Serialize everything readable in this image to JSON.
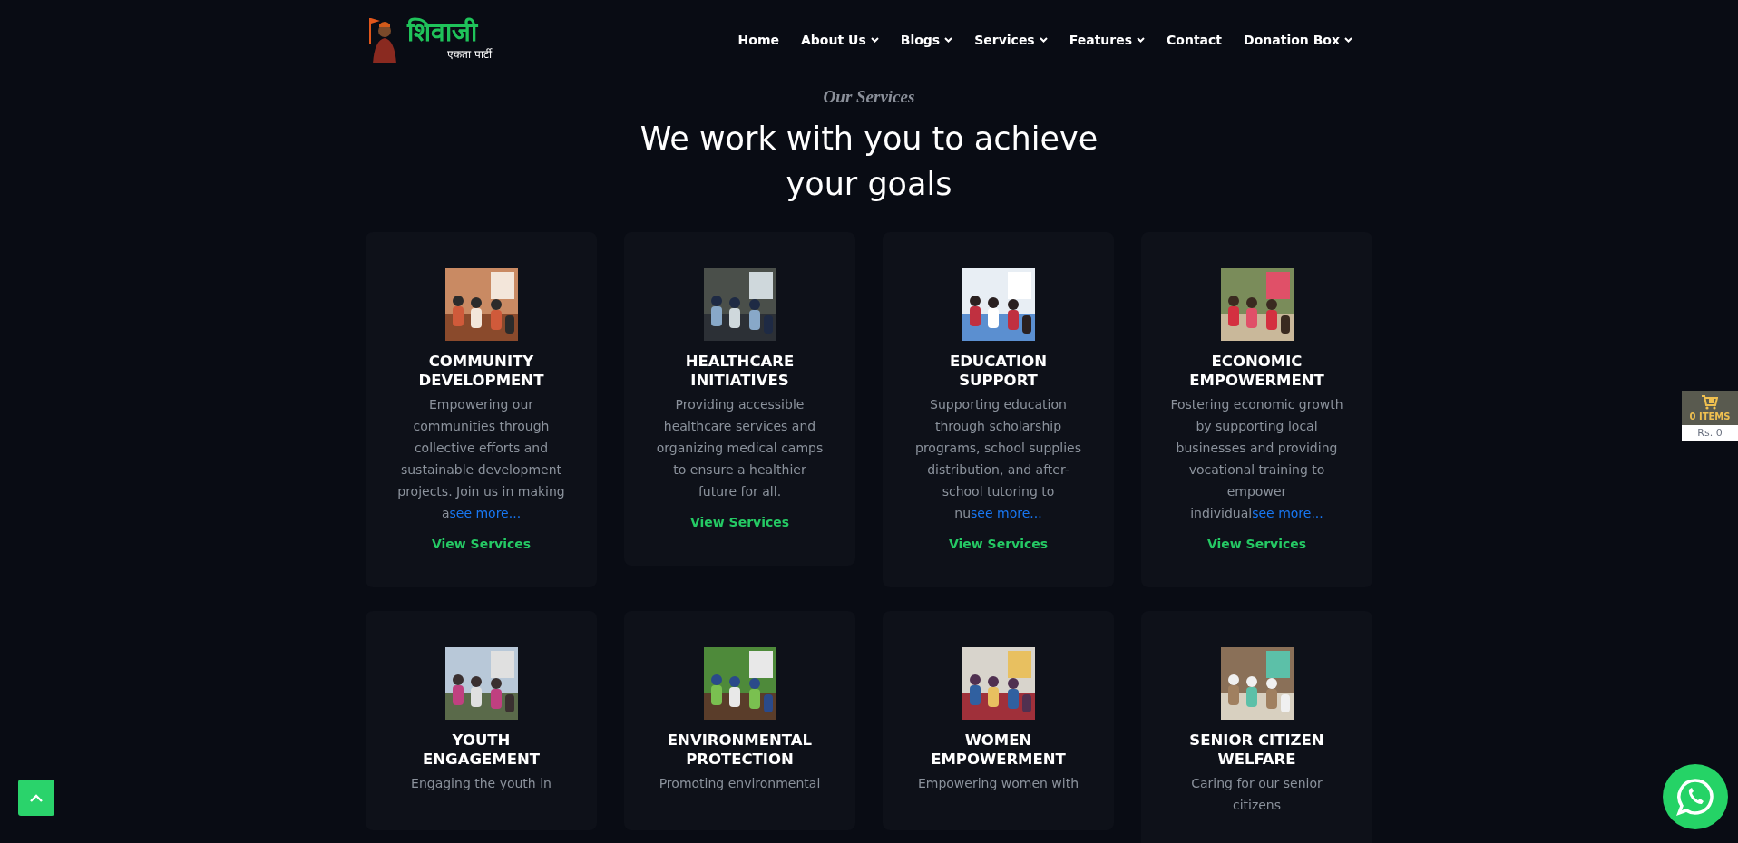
{
  "logo": {
    "title": "शिवाजी",
    "subtitle": "एकता पार्टी"
  },
  "nav": [
    {
      "label": "Home",
      "dropdown": false
    },
    {
      "label": "About Us",
      "dropdown": true
    },
    {
      "label": "Blogs",
      "dropdown": true
    },
    {
      "label": "Services",
      "dropdown": true
    },
    {
      "label": "Features",
      "dropdown": true
    },
    {
      "label": "Contact",
      "dropdown": false
    },
    {
      "label": "Donation Box",
      "dropdown": true
    }
  ],
  "section": {
    "eyebrow": "Our Services",
    "heading": "We work with you to achieve your goals"
  },
  "services": [
    {
      "title": "COMMUNITY DEVELOPMENT",
      "description": "Empowering our communities through collective efforts and sustainable development projects. Join us in making a",
      "link": "see more...",
      "action": "View Services"
    },
    {
      "title": "HEALTHCARE INITIATIVES",
      "description": "Providing accessible healthcare services and organizing medical camps to ensure a healthier future for all.",
      "action": "View Services"
    },
    {
      "title": "EDUCATION SUPPORT",
      "description": "Supporting education through scholarship programs, school supplies distribution, and after-school tutoring to nu",
      "link": "see more...",
      "action": "View Services"
    },
    {
      "title": "ECONOMIC EMPOWERMENT",
      "description": "Fostering economic growth by supporting local businesses and providing vocational training to empower individual",
      "link": "see more...",
      "action": "View Services"
    },
    {
      "title": "YOUTH ENGAGEMENT",
      "description": "Engaging the youth in"
    },
    {
      "title": "ENVIRONMENTAL PROTECTION",
      "description": "Promoting environmental"
    },
    {
      "title": "WOMEN EMPOWERMENT",
      "description": "Empowering women with"
    },
    {
      "title": "SENIOR CITIZEN WELFARE",
      "description": "Caring for our senior citizens"
    }
  ],
  "cart": {
    "items": "0 ITEMS",
    "total": "Rs. 0"
  }
}
